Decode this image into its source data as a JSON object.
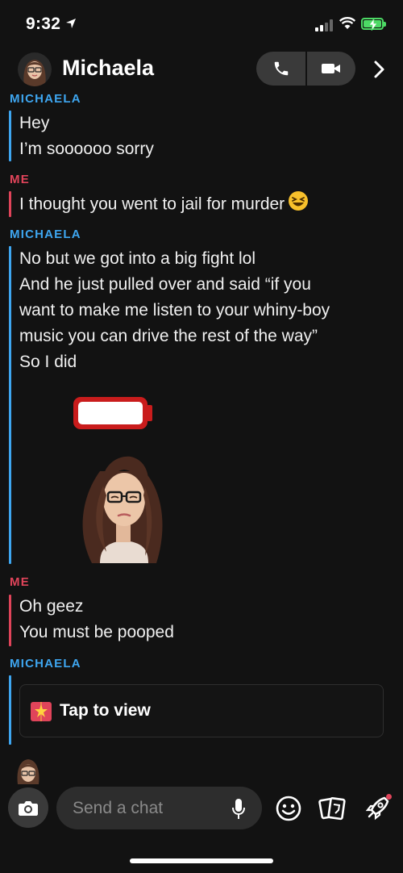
{
  "status_bar": {
    "time": "9:32"
  },
  "header": {
    "contact_name": "Michaela"
  },
  "chat": {
    "groups": [
      {
        "sender": "MICHAELA",
        "messages": [
          "Hey",
          "I’m soooooo sorry"
        ]
      },
      {
        "sender": "ME",
        "messages": [
          "I thought you went to jail for murder"
        ]
      },
      {
        "sender": "MICHAELA",
        "messages": [
          "No but we got into a big fight lol",
          "And he just pulled over and said “if you",
          "want to make me listen to your whiny-boy",
          "music you can drive the rest of the way”",
          "So I did"
        ]
      },
      {
        "sender": "ME",
        "messages": [
          "Oh geez",
          "You must be pooped"
        ]
      },
      {
        "sender": "MICHAELA",
        "snap_label": "Tap to view"
      }
    ]
  },
  "composer": {
    "placeholder": "Send a chat"
  },
  "colors": {
    "background": "#121212",
    "contact_accent": "#3ea6f0",
    "me_accent": "#e0445a",
    "battery": "#4cd964"
  },
  "icons": {
    "location": "location-arrow-icon",
    "call": "phone-icon",
    "video": "video-camera-icon",
    "more": "chevron-right-icon",
    "camera": "camera-icon",
    "mic": "microphone-icon",
    "bitmoji": "smiley-icon",
    "stickers": "sticker-cards-icon",
    "games": "rocket-icon",
    "snap": "gift-snap-icon",
    "emoji": "laughing-face-emoji"
  }
}
